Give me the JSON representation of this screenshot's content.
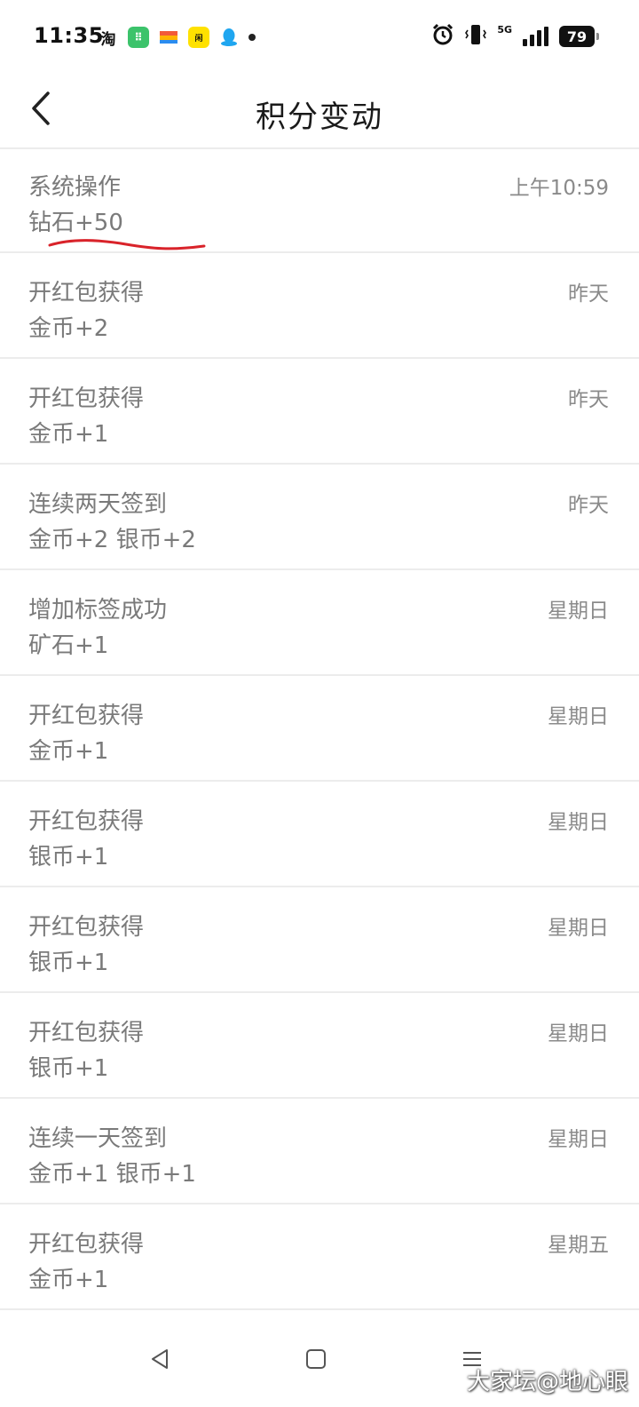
{
  "status_bar": {
    "time": "11:35",
    "taobao_label": "淘",
    "network": "5G",
    "battery": "79"
  },
  "header": {
    "title": "积分变动"
  },
  "records": [
    {
      "title": "系统操作",
      "detail": "钻石+50",
      "time": "上午10:59"
    },
    {
      "title": "开红包获得",
      "detail": "金币+2",
      "time": "昨天"
    },
    {
      "title": "开红包获得",
      "detail": "金币+1",
      "time": "昨天"
    },
    {
      "title": "连续两天签到",
      "detail": "金币+2 银币+2",
      "time": "昨天"
    },
    {
      "title": "增加标签成功",
      "detail": "矿石+1",
      "time": "星期日"
    },
    {
      "title": "开红包获得",
      "detail": "金币+1",
      "time": "星期日"
    },
    {
      "title": "开红包获得",
      "detail": "银币+1",
      "time": "星期日"
    },
    {
      "title": "开红包获得",
      "detail": "银币+1",
      "time": "星期日"
    },
    {
      "title": "开红包获得",
      "detail": "银币+1",
      "time": "星期日"
    },
    {
      "title": "连续一天签到",
      "detail": "金币+1 银币+1",
      "time": "星期日"
    },
    {
      "title": "开红包获得",
      "detail": "金币+1",
      "time": "星期五"
    }
  ],
  "watermark": "大家坛@地心眼",
  "colors": {
    "annotation": "#d9232a",
    "text_secondary": "#7a7a7a",
    "divider": "#ececec"
  }
}
